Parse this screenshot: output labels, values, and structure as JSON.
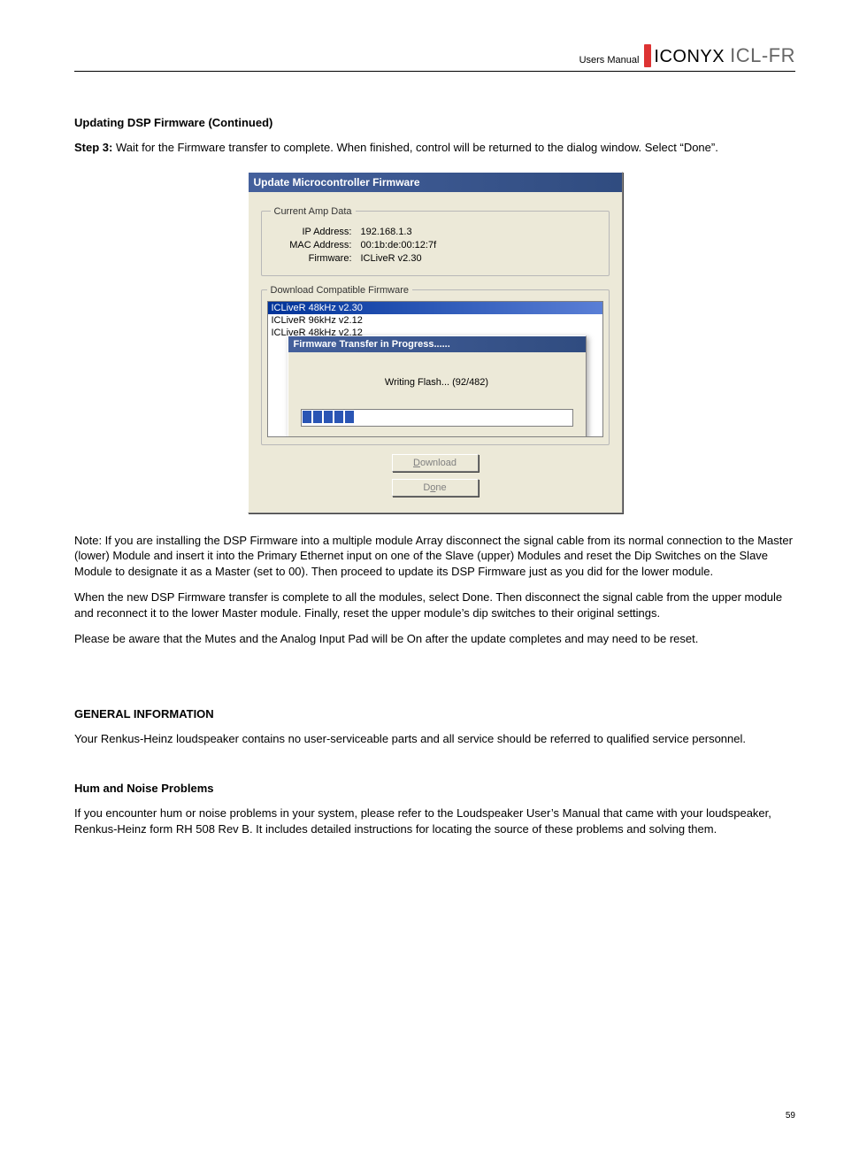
{
  "header": {
    "users_manual": "Users Manual",
    "brand": "ICONYX",
    "product": "ICL-FR"
  },
  "title_a": "Updating DSP Firmware (Continued)",
  "step3_label": "Step 3:",
  "step3_text": " Wait for the Firmware transfer to complete. When finished, control will be returned to the dialog window. Select “Done”.",
  "dialog": {
    "title": "Update Microcontroller Firmware",
    "current_group": "Current Amp Data",
    "ip_label": "IP Address:",
    "ip_value": "192.168.1.3",
    "mac_label": "MAC Address:",
    "mac_value": "00:1b:de:00:12:7f",
    "fw_label": "Firmware:",
    "fw_value": "ICLiveR v2.30",
    "download_group": "Download Compatible Firmware",
    "fw_list": [
      "ICLiveR 48kHz v2.30",
      "ICLiveR 96kHz v2.12",
      "ICLiveR 48kHz v2.12"
    ],
    "progress_title": "Firmware Transfer in Progress......",
    "progress_msg": "Writing Flash... (92/482)",
    "download_btn": "Download",
    "done_btn": "Done"
  },
  "note_para": "Note: If you are installing the DSP Firmware into a multiple module Array disconnect the signal cable from its normal connection to the Master (lower) Module and insert it into the Primary Ethernet input on one of the Slave (upper) Modules and reset the Dip Switches on the Slave Module to designate it as a Master (set to 00). Then proceed to update its DSP Firmware just as you did for the lower module.",
  "note_para2": "When the new DSP Firmware transfer is complete to all the modules, select Done. Then disconnect the signal cable from the upper module and reconnect it to the lower Master module. Finally, reset the upper module’s dip switches to their original settings.",
  "note_para3": "Please be aware that the Mutes and the Analog Input Pad will be On after the update completes and may need to be reset.",
  "general_title": "GENERAL INFORMATION",
  "general_text": "Your Renkus-Heinz loudspeaker contains no user-serviceable parts and all service should be referred to qualified service personnel.",
  "hum_title": "Hum and Noise Problems",
  "hum_text": "If you encounter hum or noise problems in your system, please refer to the Loudspeaker User’s Manual that came with your loudspeaker, Renkus-Heinz form RH 508 Rev B. It includes detailed instructions for locating the source of these problems and solving them.",
  "page_number": "59"
}
